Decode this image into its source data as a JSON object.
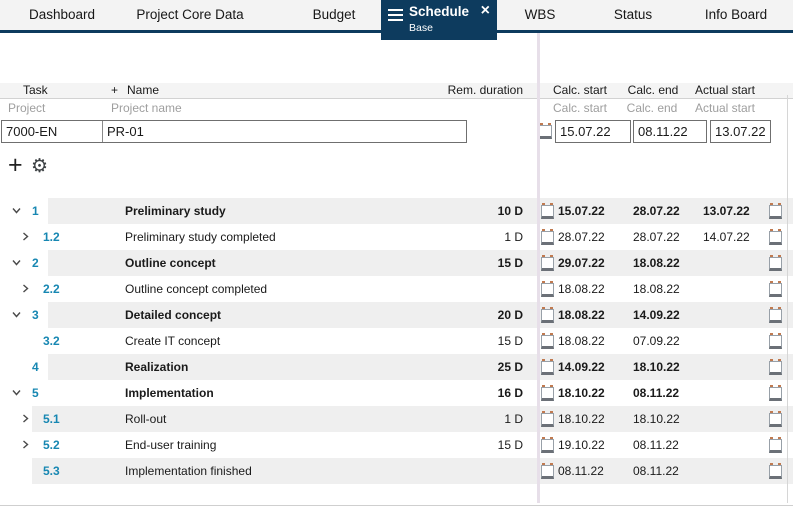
{
  "colors": {
    "accent_navy": "#0d3b5e",
    "link_blue": "#1787b2",
    "zebra_grey": "#efefef",
    "divider_lavender": "#e7dfe9",
    "separator_grey": "#d6d6d6",
    "tabbar_bg": "#f3f3f3"
  },
  "tabs": [
    {
      "label": "Dashboard"
    },
    {
      "label": "Project Core Data"
    },
    {
      "label": "Budget"
    },
    {
      "label": "Schedule",
      "subtitle": "Base",
      "close": "×",
      "active": true
    },
    {
      "label": "WBS"
    },
    {
      "label": "Status"
    },
    {
      "label": "Info Board"
    }
  ],
  "toolbar": {
    "add": "+",
    "settings": "⚙"
  },
  "table": {
    "headers": {
      "task": "Task",
      "add": "+",
      "name": "Name",
      "rem_duration": "Rem. duration",
      "calc_start": "Calc. start",
      "calc_end": "Calc. end",
      "actual_start": "Actual start"
    },
    "filter_labels": {
      "task": "Project",
      "name": "Project name",
      "calc_start": "Calc. start",
      "calc_end": "Calc. end",
      "actual_start": "Actual start"
    },
    "filter_values": {
      "task": "7000-EN",
      "name": "PR-01",
      "calc_start": "15.07.22",
      "calc_end": "08.11.22",
      "actual_start": "13.07.22"
    },
    "rows": [
      {
        "num": "1",
        "name": "Preliminary study",
        "duration": "10 D",
        "calc_start": "15.07.22",
        "calc_end": "28.07.22",
        "actual_start": "13.07.22",
        "level": 1,
        "bold": true,
        "chevron": "down",
        "shaded": true
      },
      {
        "num": "1.2",
        "name": "Preliminary study completed",
        "duration": "1 D",
        "calc_start": "28.07.22",
        "calc_end": "28.07.22",
        "actual_start": "14.07.22",
        "level": 2,
        "bold": false,
        "chevron": "right",
        "shaded": false
      },
      {
        "num": "2",
        "name": "Outline concept",
        "duration": "15 D",
        "calc_start": "29.07.22",
        "calc_end": "18.08.22",
        "actual_start": "",
        "level": 1,
        "bold": true,
        "chevron": "down",
        "shaded": true
      },
      {
        "num": "2.2",
        "name": "Outline concept completed",
        "duration": "",
        "calc_start": "18.08.22",
        "calc_end": "18.08.22",
        "actual_start": "",
        "level": 2,
        "bold": false,
        "chevron": "right",
        "shaded": false
      },
      {
        "num": "3",
        "name": "Detailed concept",
        "duration": "20 D",
        "calc_start": "18.08.22",
        "calc_end": "14.09.22",
        "actual_start": "",
        "level": 1,
        "bold": true,
        "chevron": "down",
        "shaded": true
      },
      {
        "num": "3.2",
        "name": "Create IT concept",
        "duration": "15 D",
        "calc_start": "18.08.22",
        "calc_end": "07.09.22",
        "actual_start": "",
        "level": 2,
        "bold": false,
        "chevron": "none",
        "shaded": false
      },
      {
        "num": "4",
        "name": "Realization",
        "duration": "25 D",
        "calc_start": "14.09.22",
        "calc_end": "18.10.22",
        "actual_start": "",
        "level": 1,
        "bold": true,
        "chevron": "none",
        "shaded": true
      },
      {
        "num": "5",
        "name": "Implementation",
        "duration": "16 D",
        "calc_start": "18.10.22",
        "calc_end": "08.11.22",
        "actual_start": "",
        "level": 1,
        "bold": true,
        "chevron": "down",
        "shaded": false
      },
      {
        "num": "5.1",
        "name": "Roll-out",
        "duration": "1 D",
        "calc_start": "18.10.22",
        "calc_end": "18.10.22",
        "actual_start": "",
        "level": 2,
        "bold": false,
        "chevron": "right",
        "shaded": true
      },
      {
        "num": "5.2",
        "name": "End-user training",
        "duration": "15 D",
        "calc_start": "19.10.22",
        "calc_end": "08.11.22",
        "actual_start": "",
        "level": 2,
        "bold": false,
        "chevron": "right",
        "shaded": false
      },
      {
        "num": "5.3",
        "name": "Implementation finished",
        "duration": "",
        "calc_start": "08.11.22",
        "calc_end": "08.11.22",
        "actual_start": "",
        "level": 2,
        "bold": false,
        "chevron": "none",
        "shaded": true
      }
    ]
  }
}
